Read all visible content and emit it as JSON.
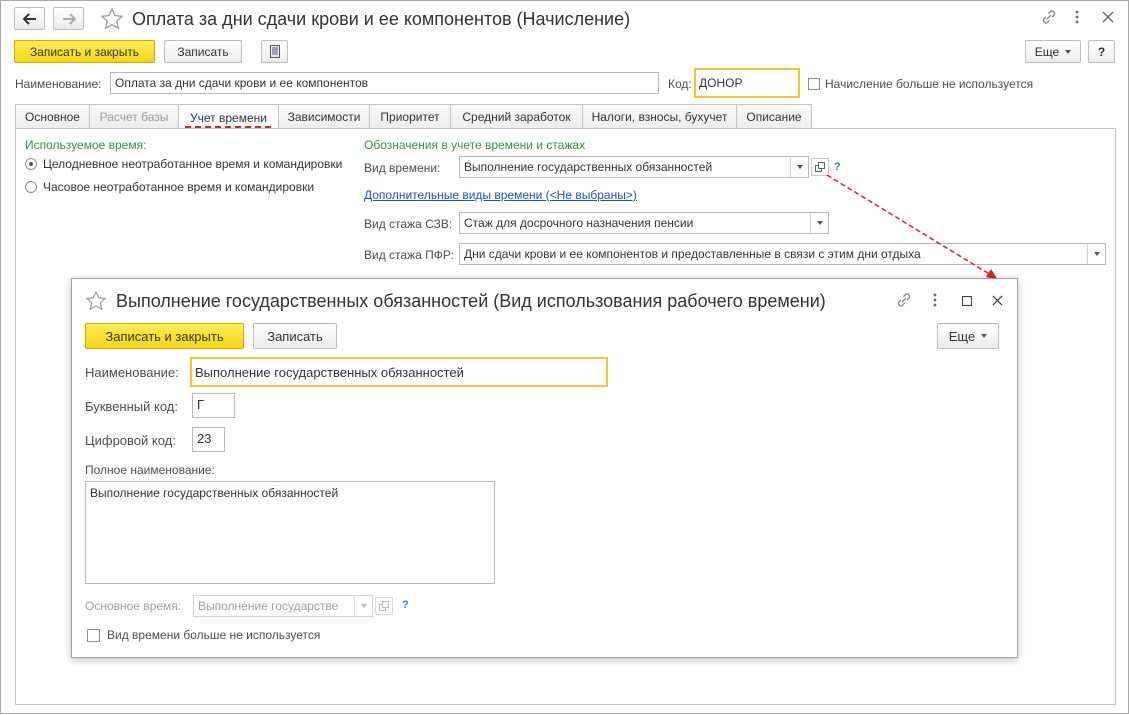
{
  "main": {
    "title": "Оплата за дни сдачи крови и ее компонентов (Начисление)",
    "toolbar": {
      "save_close": "Записать и закрыть",
      "save": "Записать",
      "more": "Еще",
      "help": "?"
    },
    "name_label": "Наименование:",
    "name_value": "Оплата за дни сдачи крови и ее компонентов",
    "code_label": "Код:",
    "code_value": "ДОНОР",
    "not_used_label": "Начисление больше не используется",
    "tabs": [
      {
        "label": "Основное"
      },
      {
        "label": "Расчет базы"
      },
      {
        "label": "Учет времени"
      },
      {
        "label": "Зависимости"
      },
      {
        "label": "Приоритет"
      },
      {
        "label": "Средний заработок"
      },
      {
        "label": "Налоги, взносы, бухучет"
      },
      {
        "label": "Описание"
      }
    ],
    "used_time_header": "Используемое время:",
    "radio_full": "Целодневное неотработанное время и командировки",
    "radio_hourly": "Часовое неотработанное время и командировки",
    "designations_header": "Обозначения в учете времени и стажах",
    "time_type_label": "Вид времени:",
    "time_type_value": "Выполнение государственных обязанностей",
    "help_q": "?",
    "extra_time_link": "Дополнительные виды времени (<Не выбраны>)",
    "szv_label": "Вид стажа СЗВ:",
    "szv_value": "Стаж для досрочного назначения пенсии",
    "pfr_label": "Вид стажа ПФР:",
    "pfr_value": "Дни сдачи крови и ее компонентов и предоставленные в связи с этим дни отдыха"
  },
  "dialog": {
    "title": "Выполнение государственных обязанностей (Вид использования рабочего времени)",
    "save_close": "Записать и закрыть",
    "save": "Записать",
    "more": "Еще",
    "name_label": "Наименование:",
    "name_value": "Выполнение государственных обязанностей",
    "letter_code_label": "Буквенный код:",
    "letter_code_value": "Г",
    "digit_code_label": "Цифровой код:",
    "digit_code_value": "23",
    "full_name_label": "Полное наименование:",
    "full_name_value": "Выполнение государственных обязанностей",
    "main_time_label": "Основное время:",
    "main_time_value": "Выполнение государстве",
    "help_q": "?",
    "not_used_label": "Вид времени больше не используется"
  },
  "colors": {
    "accent_yellow": "#f5d515",
    "green_header": "#3a8f4a",
    "link_blue": "#1a56b8",
    "arrow_red": "#e02020"
  }
}
